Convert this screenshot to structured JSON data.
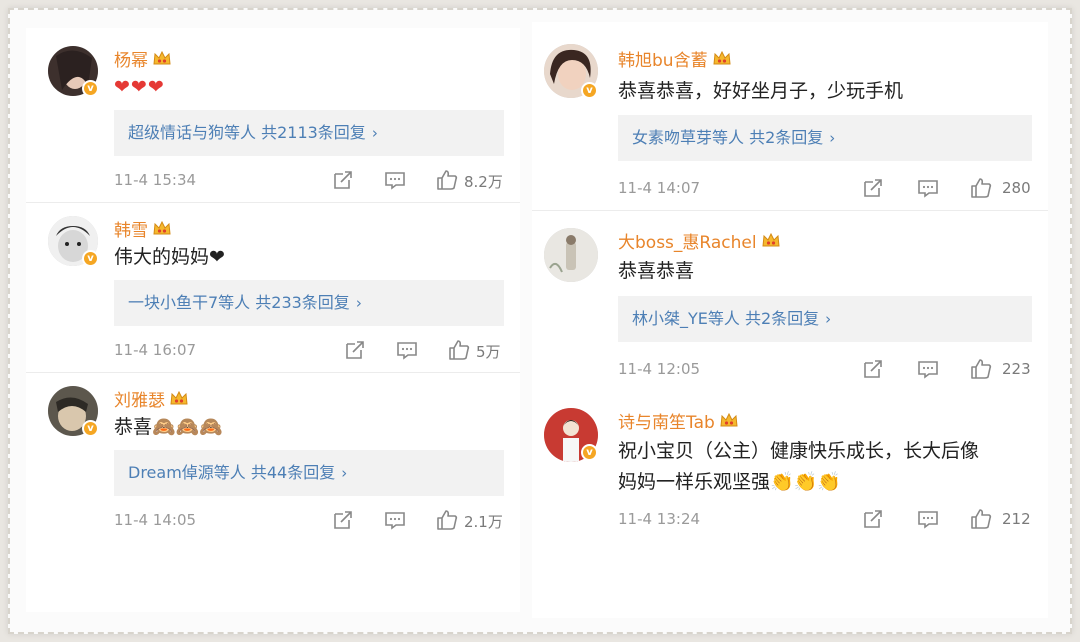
{
  "left": [
    {
      "name": "杨幂",
      "text": "❤❤❤",
      "reply": "超级情话与狗等人 共2113条回复",
      "time": "11-4 15:34",
      "likes": "8.2万",
      "avatar_color": "#5a4a46"
    },
    {
      "name": "韩雪",
      "text": "伟大的妈妈❤",
      "reply": "一块小鱼干7等人 共233条回复",
      "time": "11-4 16:07",
      "likes": "5万",
      "avatar_color": "#8d8d8d"
    },
    {
      "name": "刘雅瑟",
      "text": "恭喜🙈🙈🙈",
      "reply": "Dream倬源等人 共44条回复",
      "time": "11-4 14:05",
      "likes": "2.1万",
      "avatar_color": "#6f6a60"
    }
  ],
  "right": [
    {
      "name": "韩旭bu含蓄",
      "text": "恭喜恭喜，好好坐月子，少玩手机",
      "reply": "女素吻草芽等人 共2条回复",
      "time": "11-4 14:07",
      "likes": "280",
      "avatar_color": "#c9a08a"
    },
    {
      "name": "大boss_惠Rachel",
      "text": "恭喜恭喜",
      "reply": "林小桀_YE等人 共2条回复",
      "time": "11-4 12:05",
      "likes": "223",
      "avatar_color": "#d9d6cf"
    },
    {
      "name": "诗与南笙Tab",
      "text_line1": "祝小宝贝（公主）健康快乐成长，长大后像",
      "text_line2": "妈妈一样乐观坚强👏👏👏",
      "time": "11-4 13:24",
      "likes": "212",
      "avatar_color": "#c83a32"
    }
  ],
  "icons": {
    "share": "share-icon",
    "comment": "comment-icon",
    "like": "like-icon",
    "crown": "vip-crown-icon",
    "verified": "verified-badge-icon"
  },
  "colors": {
    "name": "#e8852b",
    "reply_link": "#4d7fb5",
    "meta": "#9a9a9a",
    "reply_bg": "#f2f2f2"
  }
}
